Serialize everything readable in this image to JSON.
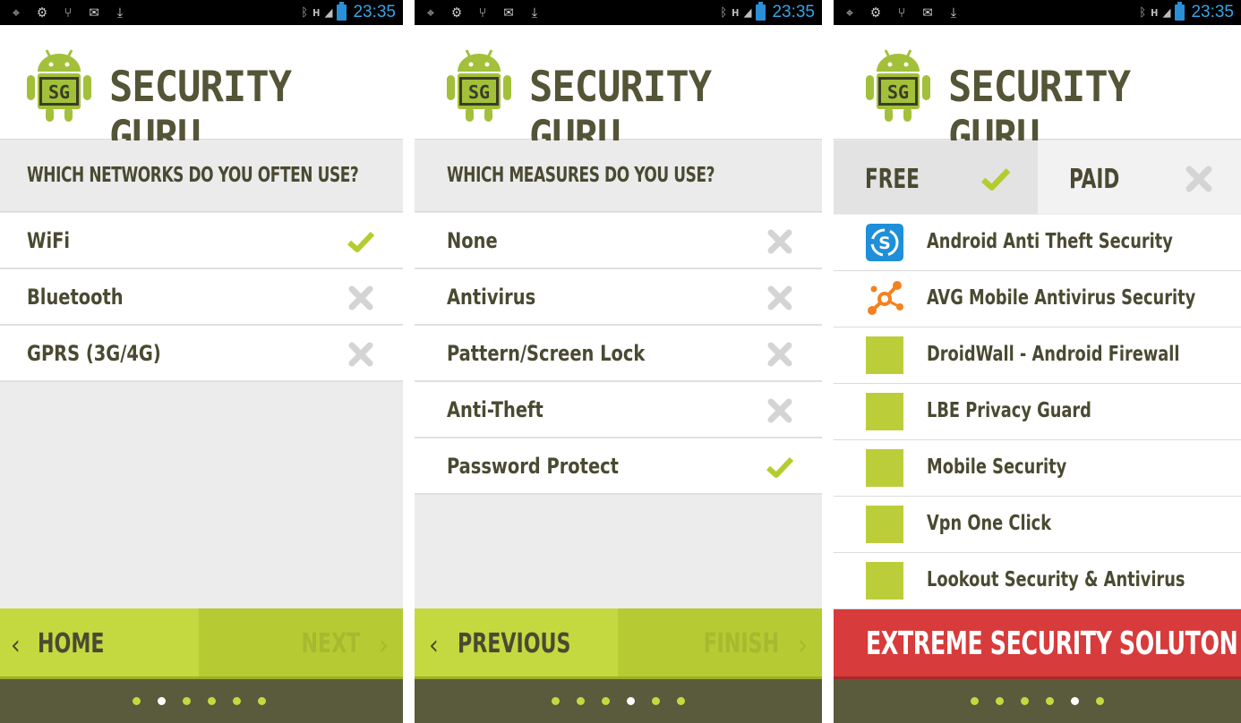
{
  "status_bar": {
    "time": "23:35",
    "network": "H"
  },
  "app": {
    "title": "SECURITY GURU",
    "logo_text": "SG"
  },
  "colors": {
    "accent": "#c4d940",
    "dark": "#5a5a3c",
    "danger": "#d73b3b",
    "ok_check": "#b5cc2e",
    "x_gray": "#d4d4d4"
  },
  "screen1": {
    "question": "WHICH NETWORKS DO YOU OFTEN USE?",
    "options": [
      {
        "label": "WiFi",
        "selected": true
      },
      {
        "label": "Bluetooth",
        "selected": false
      },
      {
        "label": "GPRS (3G/4G)",
        "selected": false
      }
    ],
    "nav": {
      "back_label": "HOME",
      "forward_label": "NEXT"
    },
    "page_index": 2,
    "page_count": 6
  },
  "screen2": {
    "question": "WHICH MEASURES DO YOU USE?",
    "options": [
      {
        "label": "None",
        "selected": false
      },
      {
        "label": "Antivirus",
        "selected": false
      },
      {
        "label": "Pattern/Screen Lock",
        "selected": false
      },
      {
        "label": "Anti-Theft",
        "selected": false
      },
      {
        "label": "Password Protect",
        "selected": true
      }
    ],
    "nav": {
      "back_label": "PREVIOUS",
      "forward_label": "FINISH"
    },
    "page_index": 4,
    "page_count": 6
  },
  "screen3": {
    "tabs": [
      {
        "label": "FREE",
        "selected": true
      },
      {
        "label": "PAID",
        "selected": false
      }
    ],
    "apps": [
      {
        "name": "Android Anti Theft Security",
        "icon": "anti-theft-icon"
      },
      {
        "name": "AVG Mobile Antivirus Security",
        "icon": "avg-icon"
      },
      {
        "name": "DroidWall - Android Firewall",
        "icon": "placeholder-square"
      },
      {
        "name": "LBE Privacy Guard",
        "icon": "placeholder-square"
      },
      {
        "name": "Mobile Security",
        "icon": "placeholder-square"
      },
      {
        "name": "Vpn One Click",
        "icon": "placeholder-square"
      },
      {
        "name": "Lookout Security & Antivirus",
        "icon": "placeholder-square"
      }
    ],
    "cta_label": "EXTREME SECURITY SOLUTON",
    "page_index": 5,
    "page_count": 6
  }
}
